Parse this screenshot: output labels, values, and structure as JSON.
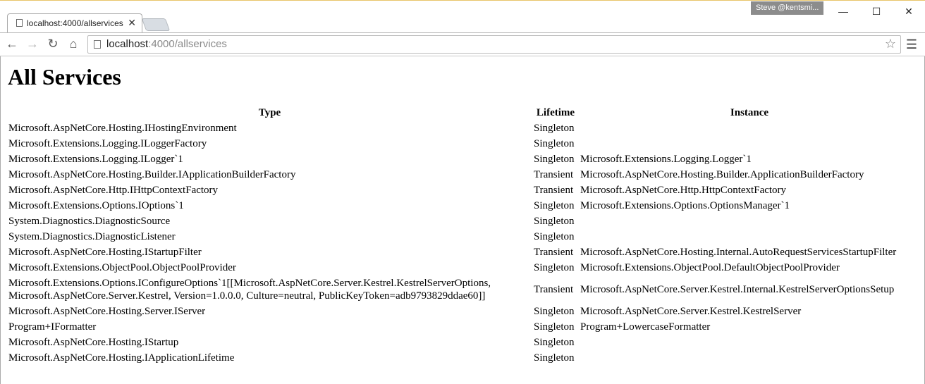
{
  "browser": {
    "tab_title": "localhost:4000/allservices",
    "profile_name": "Steve @kentsmi...",
    "url_host": "localhost",
    "url_rest": ":4000/allservices",
    "icons": [
      "back-icon",
      "forward-icon",
      "reload-icon",
      "home-icon",
      "star-icon",
      "menu-icon"
    ]
  },
  "page": {
    "title": "All Services",
    "headers": {
      "type": "Type",
      "lifetime": "Lifetime",
      "instance": "Instance"
    },
    "rows": [
      {
        "type": "Microsoft.AspNetCore.Hosting.IHostingEnvironment",
        "lifetime": "Singleton",
        "instance": ""
      },
      {
        "type": "Microsoft.Extensions.Logging.ILoggerFactory",
        "lifetime": "Singleton",
        "instance": ""
      },
      {
        "type": "Microsoft.Extensions.Logging.ILogger`1",
        "lifetime": "Singleton",
        "instance": "Microsoft.Extensions.Logging.Logger`1"
      },
      {
        "type": "Microsoft.AspNetCore.Hosting.Builder.IApplicationBuilderFactory",
        "lifetime": "Transient",
        "instance": "Microsoft.AspNetCore.Hosting.Builder.ApplicationBuilderFactory"
      },
      {
        "type": "Microsoft.AspNetCore.Http.IHttpContextFactory",
        "lifetime": "Transient",
        "instance": "Microsoft.AspNetCore.Http.HttpContextFactory"
      },
      {
        "type": "Microsoft.Extensions.Options.IOptions`1",
        "lifetime": "Singleton",
        "instance": "Microsoft.Extensions.Options.OptionsManager`1"
      },
      {
        "type": "System.Diagnostics.DiagnosticSource",
        "lifetime": "Singleton",
        "instance": ""
      },
      {
        "type": "System.Diagnostics.DiagnosticListener",
        "lifetime": "Singleton",
        "instance": ""
      },
      {
        "type": "Microsoft.AspNetCore.Hosting.IStartupFilter",
        "lifetime": "Transient",
        "instance": "Microsoft.AspNetCore.Hosting.Internal.AutoRequestServicesStartupFilter"
      },
      {
        "type": "Microsoft.Extensions.ObjectPool.ObjectPoolProvider",
        "lifetime": "Singleton",
        "instance": "Microsoft.Extensions.ObjectPool.DefaultObjectPoolProvider"
      },
      {
        "type": "Microsoft.Extensions.Options.IConfigureOptions`1[[Microsoft.AspNetCore.Server.Kestrel.KestrelServerOptions, Microsoft.AspNetCore.Server.Kestrel, Version=1.0.0.0, Culture=neutral, PublicKeyToken=adb9793829ddae60]]",
        "lifetime": "Transient",
        "instance": "Microsoft.AspNetCore.Server.Kestrel.Internal.KestrelServerOptionsSetup"
      },
      {
        "type": "Microsoft.AspNetCore.Hosting.Server.IServer",
        "lifetime": "Singleton",
        "instance": "Microsoft.AspNetCore.Server.Kestrel.KestrelServer"
      },
      {
        "type": "Program+IFormatter",
        "lifetime": "Singleton",
        "instance": "Program+LowercaseFormatter"
      },
      {
        "type": "Microsoft.AspNetCore.Hosting.IStartup",
        "lifetime": "Singleton",
        "instance": ""
      },
      {
        "type": "Microsoft.AspNetCore.Hosting.IApplicationLifetime",
        "lifetime": "Singleton",
        "instance": ""
      }
    ]
  }
}
